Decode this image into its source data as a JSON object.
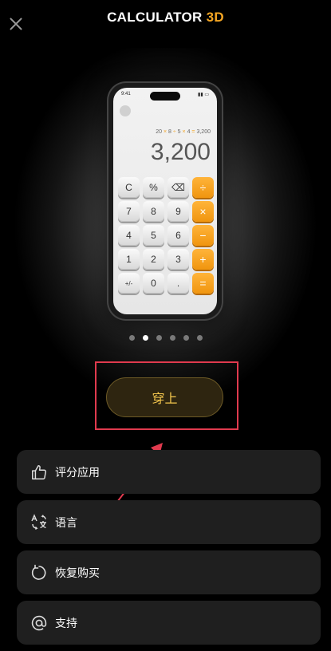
{
  "header": {
    "title_main": "CALCULATOR",
    "title_accent": "3D"
  },
  "preview": {
    "status_time": "9:41",
    "expression_a": "20",
    "expression_b": "8",
    "expression_c": "5",
    "expression_d": "4",
    "expression_e": "3,200",
    "result": "3,200",
    "keys": [
      "C",
      "%",
      "⌫",
      "÷",
      "7",
      "8",
      "9",
      "×",
      "4",
      "5",
      "6",
      "−",
      "1",
      "2",
      "3",
      "+",
      "+/-",
      "0",
      ".",
      "="
    ]
  },
  "pager": {
    "total": 6,
    "active_index": 1
  },
  "apply_button": {
    "label": "穿上"
  },
  "menu": {
    "rate": {
      "label": "评分应用",
      "icon": "thumbs-up-icon"
    },
    "language": {
      "label": "语言",
      "icon": "translate-icon"
    },
    "restore": {
      "label": "恢复购买",
      "icon": "restore-icon"
    },
    "support": {
      "label": "支持",
      "icon": "at-icon"
    }
  },
  "colors": {
    "accent": "#f5a623",
    "apply_text": "#f3c64d",
    "highlight": "#e03a4e"
  }
}
